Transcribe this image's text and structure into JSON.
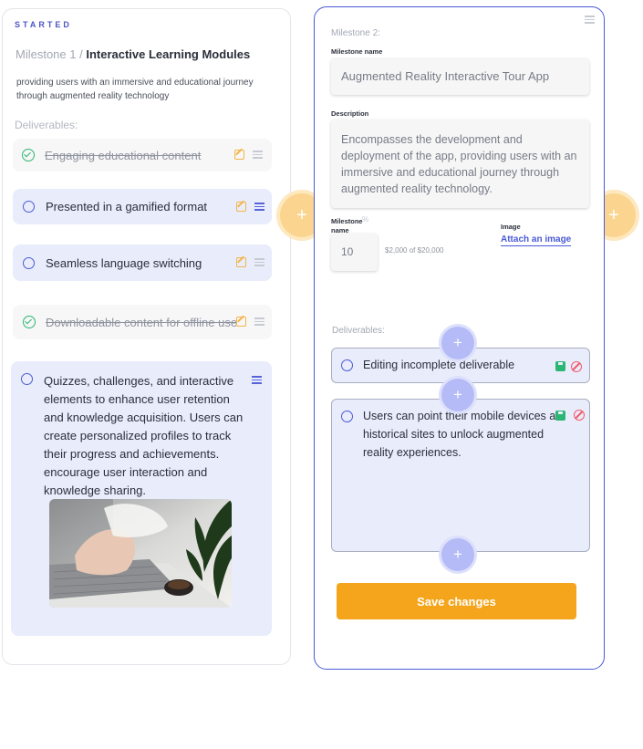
{
  "left": {
    "status": "STARTED",
    "milestone_prefix": "Milestone 1 / ",
    "milestone_name": "Interactive Learning Modules",
    "description": "providing users with an immersive and educational journey through augmented reality technology",
    "deliverables_label": "Deliverables:",
    "items": [
      {
        "label": "Engaging educational content",
        "done": true
      },
      {
        "label": "Presented in a gamified format",
        "done": false
      },
      {
        "label": "Seamless language switching",
        "done": false
      },
      {
        "label": "Downloadable content for offline use",
        "done": true
      }
    ],
    "expanded_item": "Quizzes, challenges, and interactive elements to enhance user retention and knowledge acquisition. Users can create personalized profiles to track their progress and achievements. encourage user interaction and knowledge sharing."
  },
  "right": {
    "milestone_label": "Milestone 2:",
    "name_label": "Milestone name",
    "name_value": "Augmented Reality Interactive Tour App",
    "description_label": "Description",
    "description_value": "Encompasses the development and deployment of the app, providing users with an immersive and educational journey through augmented reality technology.",
    "percent_label": "Milestone name",
    "percent_sign": "%",
    "percent_value": "10",
    "amount_text": "$2,000 of $20,000",
    "image_label": "Image",
    "attach_link": "Attach an image",
    "deliverables_label": "Deliverables:",
    "editing_item": "Editing incomplete deliverable",
    "editing_big_item": "Users can point their mobile devices at historical sites to unlock augmented reality experiences.",
    "save_button": "Save changes"
  },
  "plus_symbol": "+",
  "colors": {
    "accent": "#4a5ad6",
    "orange": "#f4a51c",
    "success": "#2bb673",
    "danger": "#f05a6a",
    "item_bg": "#e9ecfb"
  }
}
